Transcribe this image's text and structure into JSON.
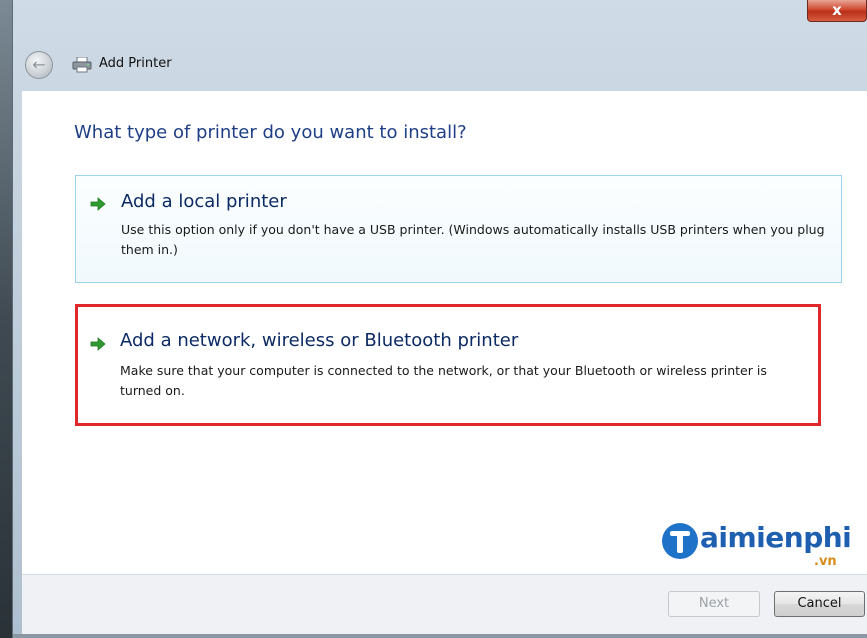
{
  "window": {
    "title": "Add Printer",
    "close_glyph": "x"
  },
  "icons": {
    "back": "back-arrow-icon",
    "printer": "printer-icon",
    "option_arrow": "green-arrow-icon"
  },
  "page": {
    "heading": "What type of printer do you want to install?"
  },
  "options": [
    {
      "title": "Add a local printer",
      "description": "Use this option only if you don't have a USB printer. (Windows automatically installs USB printers when you plug them in.)"
    },
    {
      "title": "Add a network, wireless or Bluetooth printer",
      "description": "Make sure that your computer is connected to the network, or that your Bluetooth or wireless printer is turned on.",
      "highlighted": true
    }
  ],
  "watermark": {
    "brand": "aimienphi",
    "domain": ".vn"
  },
  "footer": {
    "next_label": "Next",
    "next_enabled": false,
    "cancel_label": "Cancel"
  },
  "colors": {
    "heading": "#1e3f86",
    "highlight_border": "#e0282a",
    "option_border": "#9ad3ea",
    "arrow_green": "#2f9a2f",
    "logo_blue": "#1e5fb0",
    "logo_orange": "#d98c1c"
  }
}
